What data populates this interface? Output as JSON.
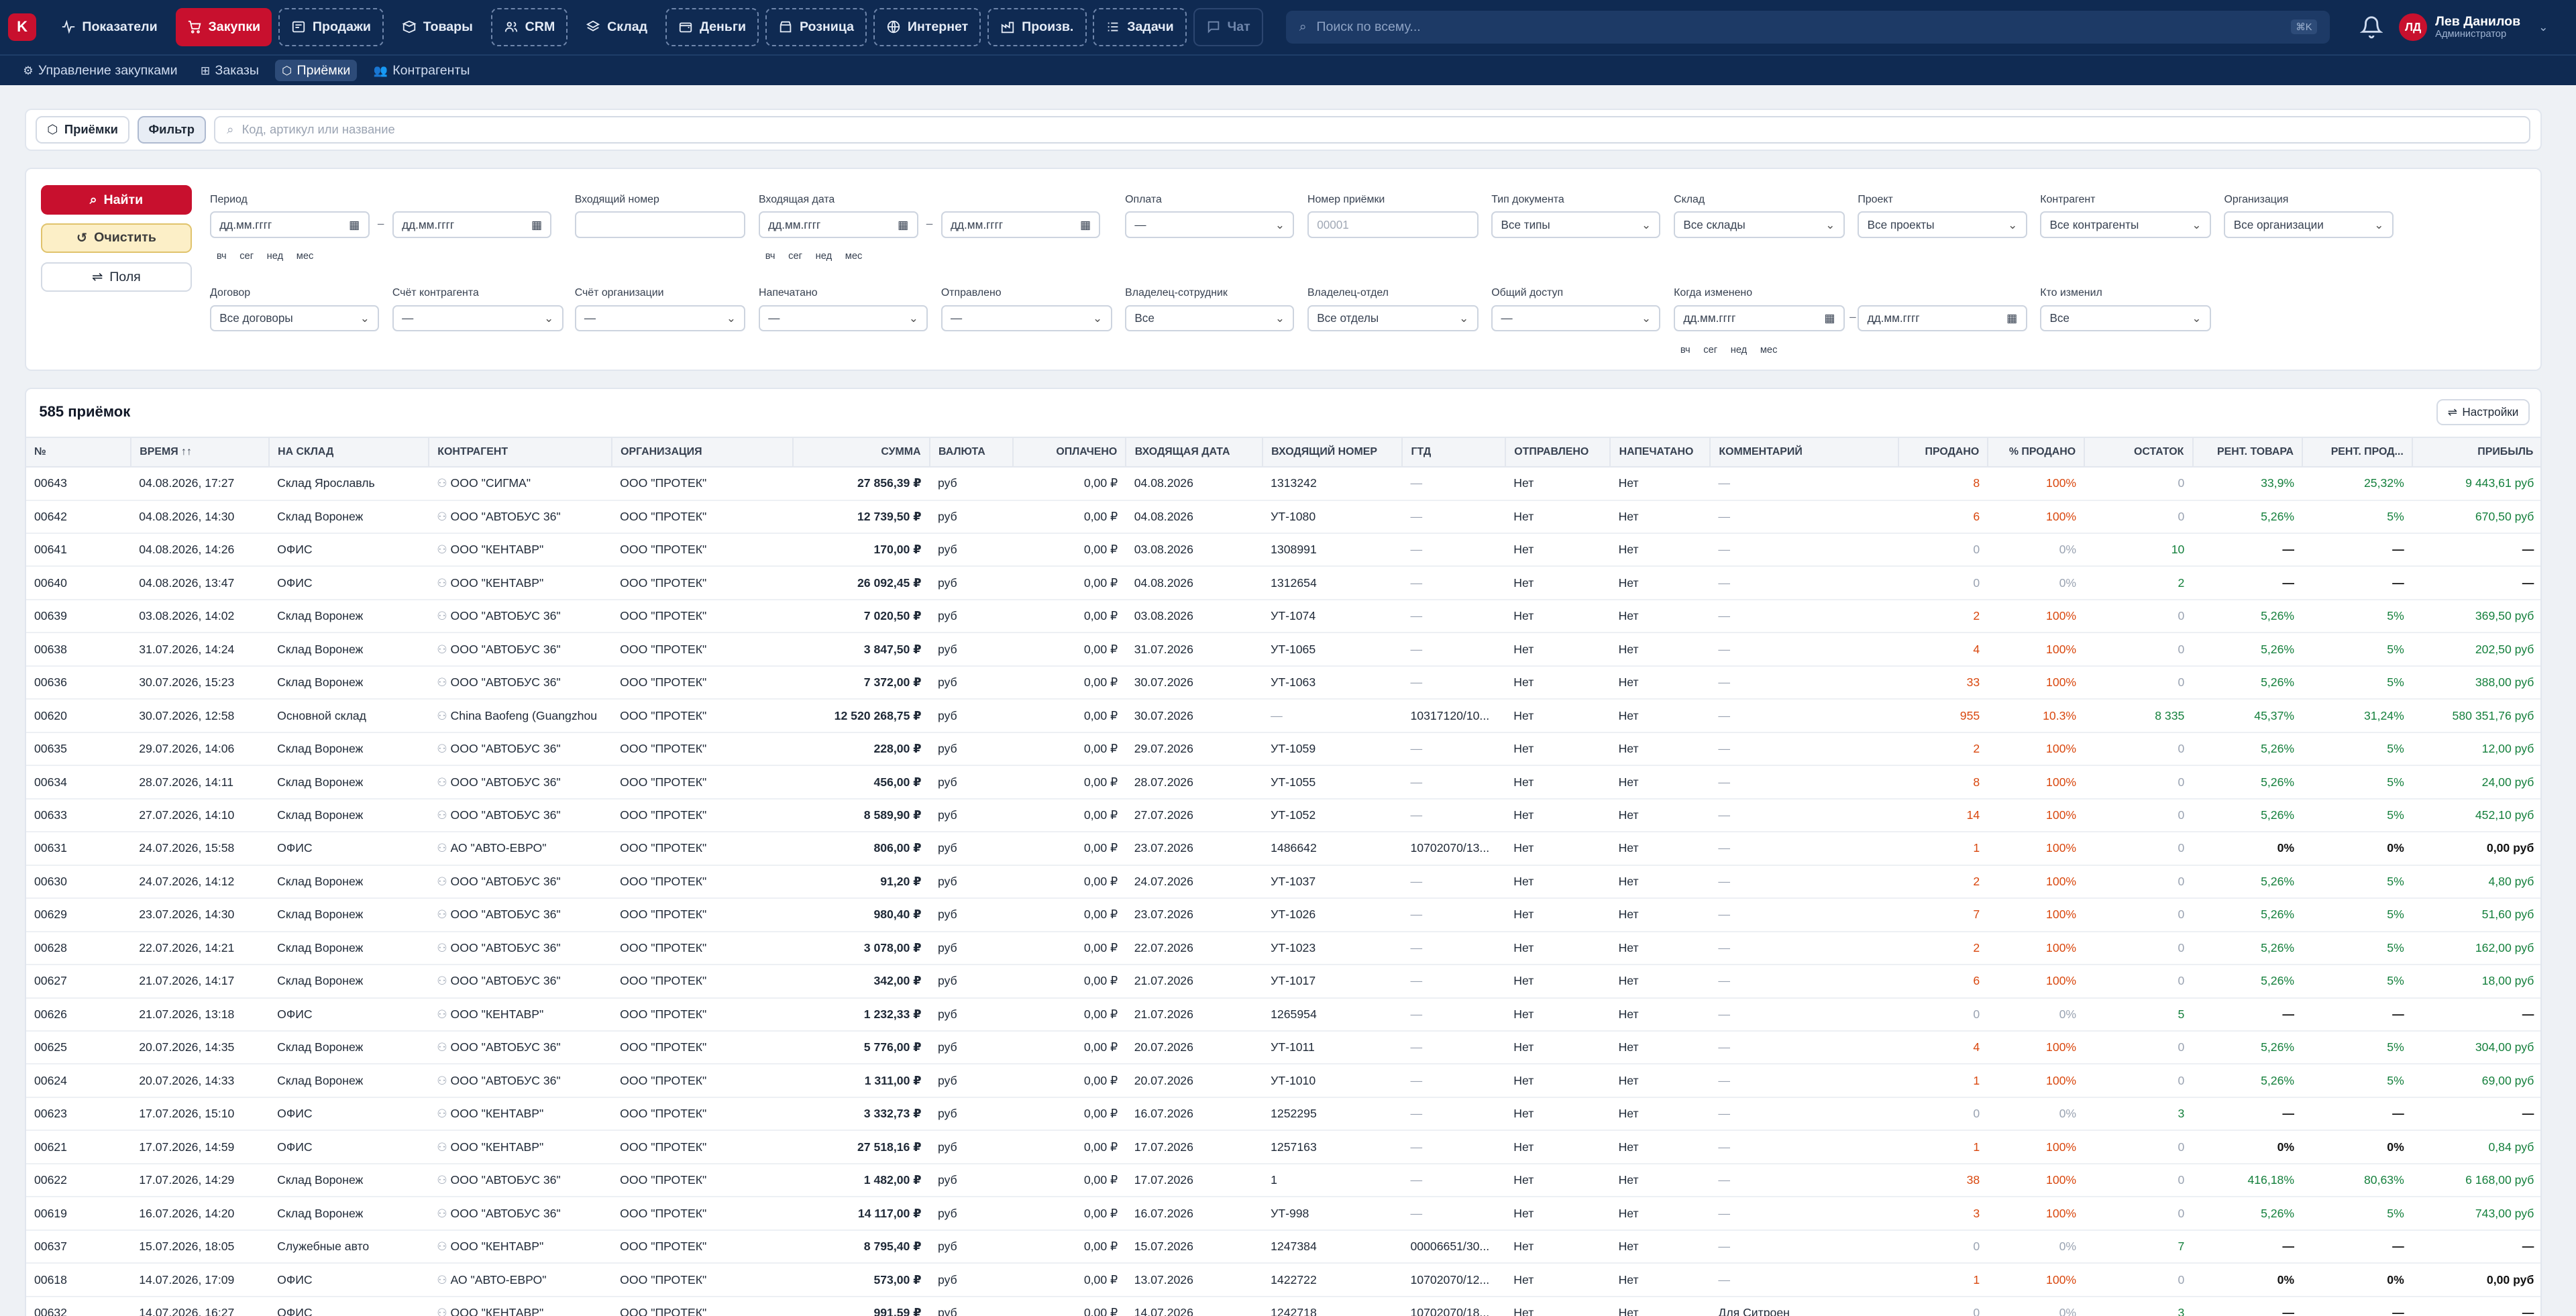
{
  "topbar": {
    "logo": "K",
    "nav": [
      {
        "label": "Показатели",
        "icon": "activity-icon",
        "style": "plain"
      },
      {
        "label": "Закупки",
        "icon": "cart-icon",
        "style": "active"
      },
      {
        "label": "Продажи",
        "icon": "sales-icon",
        "style": "dashed"
      },
      {
        "label": "Товары",
        "icon": "box-icon",
        "style": "plain"
      },
      {
        "label": "CRM",
        "icon": "users-icon",
        "style": "dashed"
      },
      {
        "label": "Склад",
        "icon": "layers-icon",
        "style": "plain"
      },
      {
        "label": "Деньги",
        "icon": "wallet-icon",
        "style": "dashed"
      },
      {
        "label": "Розница",
        "icon": "store-icon",
        "style": "dashed"
      },
      {
        "label": "Интернет",
        "icon": "globe-icon",
        "style": "dashed"
      },
      {
        "label": "Произв.",
        "icon": "factory-icon",
        "style": "dashed"
      },
      {
        "label": "Задачи",
        "icon": "tasks-icon",
        "style": "dashed"
      },
      {
        "label": "Чат",
        "icon": "chat-icon",
        "style": "disabled"
      }
    ],
    "search_placeholder": "Поиск по всему...",
    "search_kbd": "⌘K",
    "user": {
      "initials": "ЛД",
      "name": "Лев Данилов",
      "role": "Администратор"
    }
  },
  "subnav": [
    {
      "label": "Управление закупками",
      "active": false
    },
    {
      "label": "Заказы",
      "active": false
    },
    {
      "label": "Приёмки",
      "active": true
    },
    {
      "label": "Контрагенты",
      "active": false
    }
  ],
  "toolbar": {
    "chip": "Приёмки",
    "filter": "Фильтр",
    "search_placeholder": "Код, артикул или название"
  },
  "filters": {
    "find": "Найти",
    "clear": "Очистить",
    "fields": "Поля",
    "date_ph": "дд.мм.гггг",
    "quick": [
      "вч",
      "сег",
      "нед",
      "мес"
    ],
    "labels": {
      "period": "Период",
      "incoming_number": "Входящий номер",
      "incoming_date": "Входящая дата",
      "payment": "Оплата",
      "receipt_number": "Номер приёмки",
      "doc_type": "Тип документа",
      "warehouse": "Склад",
      "project": "Проект",
      "counterparty": "Контрагент",
      "organization": "Организация",
      "contract": "Договор",
      "cp_account": "Счёт контрагента",
      "org_account": "Счёт организации",
      "printed": "Напечатано",
      "sent": "Отправлено",
      "owner_employee": "Владелец-сотрудник",
      "owner_dept": "Владелец-отдел",
      "shared": "Общий доступ",
      "changed_when": "Когда изменено",
      "changed_who": "Кто изменил"
    },
    "values": {
      "payment": "—",
      "receipt_number_ph": "00001",
      "doc_type": "Все типы",
      "warehouse": "Все склады",
      "project": "Все проекты",
      "counterparty": "Все контрагенты",
      "organization": "Все организации",
      "contract": "Все договоры",
      "cp_account": "—",
      "org_account": "—",
      "printed": "—",
      "sent": "—",
      "owner_employee": "Все",
      "owner_dept": "Все отделы",
      "shared": "—",
      "changed_who": "Все"
    }
  },
  "table": {
    "count": "585 приёмок",
    "settings": "Настройки",
    "columns": [
      "№",
      "ВРЕМЯ ↑↑",
      "НА СКЛАД",
      "КОНТРАГЕНТ",
      "ОРГАНИЗАЦИЯ",
      "СУММА",
      "ВАЛЮТА",
      "ОПЛАЧЕНО",
      "ВХОДЯЩАЯ ДАТА",
      "ВХОДЯЩИЙ НОМЕР",
      "ГТД",
      "ОТПРАВЛЕНО",
      "НАПЕЧАТАНО",
      "КОММЕНТАРИЙ",
      "ПРОДАНО",
      "% ПРОДАНО",
      "ОСТАТОК",
      "РЕНТ. ТОВАРА",
      "РЕНТ. ПРОД...",
      "ПРИБЫЛЬ"
    ],
    "rows": [
      [
        "00643",
        "04.08.2026, 17:27",
        "Склад Ярославль",
        "ООО \"СИГМА\"",
        "ООО \"ПРОТЕК\"",
        "27 856,39 ₽",
        "руб",
        "0,00 ₽",
        "04.08.2026",
        "1313242",
        "—",
        "Нет",
        "Нет",
        "—",
        "8",
        "100%",
        "0",
        "33,9%",
        "25,32%",
        "9 443,61 руб"
      ],
      [
        "00642",
        "04.08.2026, 14:30",
        "Склад Воронеж",
        "ООО \"АВТОБУС 36\"",
        "ООО \"ПРОТЕК\"",
        "12 739,50 ₽",
        "руб",
        "0,00 ₽",
        "04.08.2026",
        "УТ-1080",
        "—",
        "Нет",
        "Нет",
        "—",
        "6",
        "100%",
        "0",
        "5,26%",
        "5%",
        "670,50 руб"
      ],
      [
        "00641",
        "04.08.2026, 14:26",
        "ОФИС",
        "ООО \"КЕНТАВР\"",
        "ООО \"ПРОТЕК\"",
        "170,00 ₽",
        "руб",
        "0,00 ₽",
        "03.08.2026",
        "1308991",
        "—",
        "Нет",
        "Нет",
        "—",
        "0",
        "0%",
        "10",
        "—",
        "—",
        "—"
      ],
      [
        "00640",
        "04.08.2026, 13:47",
        "ОФИС",
        "ООО \"КЕНТАВР\"",
        "ООО \"ПРОТЕК\"",
        "26 092,45 ₽",
        "руб",
        "0,00 ₽",
        "04.08.2026",
        "1312654",
        "—",
        "Нет",
        "Нет",
        "—",
        "0",
        "0%",
        "2",
        "—",
        "—",
        "—"
      ],
      [
        "00639",
        "03.08.2026, 14:02",
        "Склад Воронеж",
        "ООО \"АВТОБУС 36\"",
        "ООО \"ПРОТЕК\"",
        "7 020,50 ₽",
        "руб",
        "0,00 ₽",
        "03.08.2026",
        "УТ-1074",
        "—",
        "Нет",
        "Нет",
        "—",
        "2",
        "100%",
        "0",
        "5,26%",
        "5%",
        "369,50 руб"
      ],
      [
        "00638",
        "31.07.2026, 14:24",
        "Склад Воронеж",
        "ООО \"АВТОБУС 36\"",
        "ООО \"ПРОТЕК\"",
        "3 847,50 ₽",
        "руб",
        "0,00 ₽",
        "31.07.2026",
        "УТ-1065",
        "—",
        "Нет",
        "Нет",
        "—",
        "4",
        "100%",
        "0",
        "5,26%",
        "5%",
        "202,50 руб"
      ],
      [
        "00636",
        "30.07.2026, 15:23",
        "Склад Воронеж",
        "ООО \"АВТОБУС 36\"",
        "ООО \"ПРОТЕК\"",
        "7 372,00 ₽",
        "руб",
        "0,00 ₽",
        "30.07.2026",
        "УТ-1063",
        "—",
        "Нет",
        "Нет",
        "—",
        "33",
        "100%",
        "0",
        "5,26%",
        "5%",
        "388,00 руб"
      ],
      [
        "00620",
        "30.07.2026, 12:58",
        "Основной склад",
        "China Baofeng (Guangzhou",
        "ООО \"ПРОТЕК\"",
        "12 520 268,75 ₽",
        "руб",
        "0,00 ₽",
        "30.07.2026",
        "—",
        "10317120/10...",
        "Нет",
        "Нет",
        "—",
        "955",
        "10.3%",
        "8 335",
        "45,37%",
        "31,24%",
        "580 351,76 руб"
      ],
      [
        "00635",
        "29.07.2026, 14:06",
        "Склад Воронеж",
        "ООО \"АВТОБУС 36\"",
        "ООО \"ПРОТЕК\"",
        "228,00 ₽",
        "руб",
        "0,00 ₽",
        "29.07.2026",
        "УТ-1059",
        "—",
        "Нет",
        "Нет",
        "—",
        "2",
        "100%",
        "0",
        "5,26%",
        "5%",
        "12,00 руб"
      ],
      [
        "00634",
        "28.07.2026, 14:11",
        "Склад Воронеж",
        "ООО \"АВТОБУС 36\"",
        "ООО \"ПРОТЕК\"",
        "456,00 ₽",
        "руб",
        "0,00 ₽",
        "28.07.2026",
        "УТ-1055",
        "—",
        "Нет",
        "Нет",
        "—",
        "8",
        "100%",
        "0",
        "5,26%",
        "5%",
        "24,00 руб"
      ],
      [
        "00633",
        "27.07.2026, 14:10",
        "Склад Воронеж",
        "ООО \"АВТОБУС 36\"",
        "ООО \"ПРОТЕК\"",
        "8 589,90 ₽",
        "руб",
        "0,00 ₽",
        "27.07.2026",
        "УТ-1052",
        "—",
        "Нет",
        "Нет",
        "—",
        "14",
        "100%",
        "0",
        "5,26%",
        "5%",
        "452,10 руб"
      ],
      [
        "00631",
        "24.07.2026, 15:58",
        "ОФИС",
        "АО \"АВТО-ЕВРО\"",
        "ООО \"ПРОТЕК\"",
        "806,00 ₽",
        "руб",
        "0,00 ₽",
        "23.07.2026",
        "1486642",
        "10702070/13...",
        "Нет",
        "Нет",
        "—",
        "1",
        "100%",
        "0",
        "0%",
        "0%",
        "0,00 руб"
      ],
      [
        "00630",
        "24.07.2026, 14:12",
        "Склад Воронеж",
        "ООО \"АВТОБУС 36\"",
        "ООО \"ПРОТЕК\"",
        "91,20 ₽",
        "руб",
        "0,00 ₽",
        "24.07.2026",
        "УТ-1037",
        "—",
        "Нет",
        "Нет",
        "—",
        "2",
        "100%",
        "0",
        "5,26%",
        "5%",
        "4,80 руб"
      ],
      [
        "00629",
        "23.07.2026, 14:30",
        "Склад Воронеж",
        "ООО \"АВТОБУС 36\"",
        "ООО \"ПРОТЕК\"",
        "980,40 ₽",
        "руб",
        "0,00 ₽",
        "23.07.2026",
        "УТ-1026",
        "—",
        "Нет",
        "Нет",
        "—",
        "7",
        "100%",
        "0",
        "5,26%",
        "5%",
        "51,60 руб"
      ],
      [
        "00628",
        "22.07.2026, 14:21",
        "Склад Воронеж",
        "ООО \"АВТОБУС 36\"",
        "ООО \"ПРОТЕК\"",
        "3 078,00 ₽",
        "руб",
        "0,00 ₽",
        "22.07.2026",
        "УТ-1023",
        "—",
        "Нет",
        "Нет",
        "—",
        "2",
        "100%",
        "0",
        "5,26%",
        "5%",
        "162,00 руб"
      ],
      [
        "00627",
        "21.07.2026, 14:17",
        "Склад Воронеж",
        "ООО \"АВТОБУС 36\"",
        "ООО \"ПРОТЕК\"",
        "342,00 ₽",
        "руб",
        "0,00 ₽",
        "21.07.2026",
        "УТ-1017",
        "—",
        "Нет",
        "Нет",
        "—",
        "6",
        "100%",
        "0",
        "5,26%",
        "5%",
        "18,00 руб"
      ],
      [
        "00626",
        "21.07.2026, 13:18",
        "ОФИС",
        "ООО \"КЕНТАВР\"",
        "ООО \"ПРОТЕК\"",
        "1 232,33 ₽",
        "руб",
        "0,00 ₽",
        "21.07.2026",
        "1265954",
        "—",
        "Нет",
        "Нет",
        "—",
        "0",
        "0%",
        "5",
        "—",
        "—",
        "—"
      ],
      [
        "00625",
        "20.07.2026, 14:35",
        "Склад Воронеж",
        "ООО \"АВТОБУС 36\"",
        "ООО \"ПРОТЕК\"",
        "5 776,00 ₽",
        "руб",
        "0,00 ₽",
        "20.07.2026",
        "УТ-1011",
        "—",
        "Нет",
        "Нет",
        "—",
        "4",
        "100%",
        "0",
        "5,26%",
        "5%",
        "304,00 руб"
      ],
      [
        "00624",
        "20.07.2026, 14:33",
        "Склад Воронеж",
        "ООО \"АВТОБУС 36\"",
        "ООО \"ПРОТЕК\"",
        "1 311,00 ₽",
        "руб",
        "0,00 ₽",
        "20.07.2026",
        "УТ-1010",
        "—",
        "Нет",
        "Нет",
        "—",
        "1",
        "100%",
        "0",
        "5,26%",
        "5%",
        "69,00 руб"
      ],
      [
        "00623",
        "17.07.2026, 15:10",
        "ОФИС",
        "ООО \"КЕНТАВР\"",
        "ООО \"ПРОТЕК\"",
        "3 332,73 ₽",
        "руб",
        "0,00 ₽",
        "16.07.2026",
        "1252295",
        "—",
        "Нет",
        "Нет",
        "—",
        "0",
        "0%",
        "3",
        "—",
        "—",
        "—"
      ],
      [
        "00621",
        "17.07.2026, 14:59",
        "ОФИС",
        "ООО \"КЕНТАВР\"",
        "ООО \"ПРОТЕК\"",
        "27 518,16 ₽",
        "руб",
        "0,00 ₽",
        "17.07.2026",
        "1257163",
        "—",
        "Нет",
        "Нет",
        "—",
        "1",
        "100%",
        "0",
        "0%",
        "0%",
        "0,84 руб"
      ],
      [
        "00622",
        "17.07.2026, 14:29",
        "Склад Воронеж",
        "ООО \"АВТОБУС 36\"",
        "ООО \"ПРОТЕК\"",
        "1 482,00 ₽",
        "руб",
        "0,00 ₽",
        "17.07.2026",
        "1",
        "—",
        "Нет",
        "Нет",
        "—",
        "38",
        "100%",
        "0",
        "416,18%",
        "80,63%",
        "6 168,00 руб"
      ],
      [
        "00619",
        "16.07.2026, 14:20",
        "Склад Воронеж",
        "ООО \"АВТОБУС 36\"",
        "ООО \"ПРОТЕК\"",
        "14 117,00 ₽",
        "руб",
        "0,00 ₽",
        "16.07.2026",
        "УТ-998",
        "—",
        "Нет",
        "Нет",
        "—",
        "3",
        "100%",
        "0",
        "5,26%",
        "5%",
        "743,00 руб"
      ],
      [
        "00637",
        "15.07.2026, 18:05",
        "Служебные авто",
        "ООО \"КЕНТАВР\"",
        "ООО \"ПРОТЕК\"",
        "8 795,40 ₽",
        "руб",
        "0,00 ₽",
        "15.07.2026",
        "1247384",
        "00006651/30...",
        "Нет",
        "Нет",
        "—",
        "0",
        "0%",
        "7",
        "—",
        "—",
        "—"
      ],
      [
        "00618",
        "14.07.2026, 17:09",
        "ОФИС",
        "АО \"АВТО-ЕВРО\"",
        "ООО \"ПРОТЕК\"",
        "573,00 ₽",
        "руб",
        "0,00 ₽",
        "13.07.2026",
        "1422722",
        "10702070/12...",
        "Нет",
        "Нет",
        "—",
        "1",
        "100%",
        "0",
        "0%",
        "0%",
        "0,00 руб"
      ],
      [
        "00632",
        "14.07.2026, 16:27",
        "ОФИС",
        "ООО \"КЕНТАВР\"",
        "ООО \"ПРОТЕК\"",
        "991,59 ₽",
        "руб",
        "0,00 ₽",
        "14.07.2026",
        "1242718",
        "10702070/18...",
        "Нет",
        "Нет",
        "Для Ситроен",
        "0",
        "0%",
        "3",
        "—",
        "—",
        "—"
      ]
    ]
  },
  "colors": {
    "brand": "#c8102e",
    "nav_bg": "#0f2a52",
    "orange": "#d9480f",
    "green": "#15803d"
  }
}
